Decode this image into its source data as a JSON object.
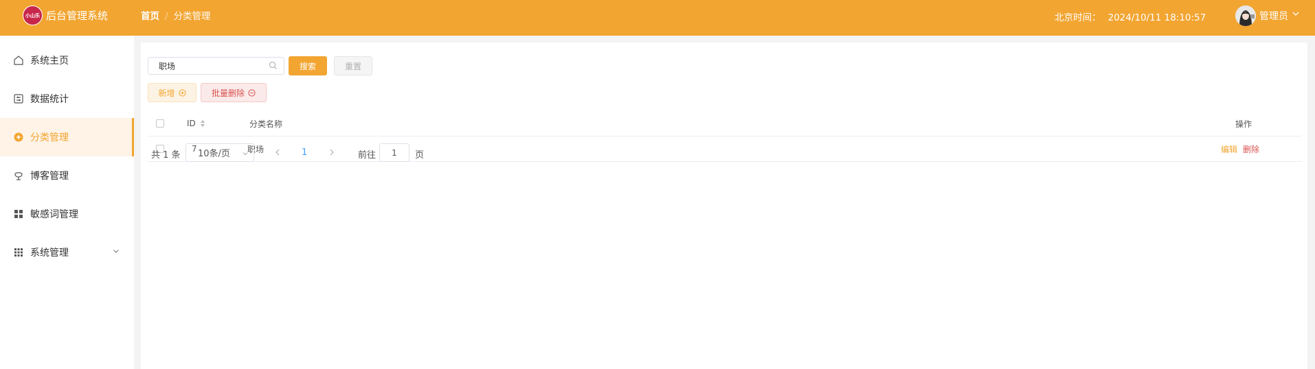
{
  "header": {
    "logo_text": "小山乐",
    "app_title": "后台管理系统",
    "breadcrumb": {
      "home": "首页",
      "separator": "/",
      "current": "分类管理"
    },
    "clock": {
      "label": "北京时间：",
      "value": "2024/10/11 18:10:57"
    },
    "user": {
      "name": "管理员"
    },
    "colors": {
      "primary": "#f2a531",
      "logo_bg": "#c8264b",
      "danger": "#d9534f",
      "link": "#409eff"
    }
  },
  "sidebar": {
    "items": [
      {
        "label": "系统主页",
        "icon": "home-icon"
      },
      {
        "label": "数据统计",
        "icon": "stats-icon"
      },
      {
        "label": "分类管理",
        "icon": "category-icon",
        "active": true
      },
      {
        "label": "博客管理",
        "icon": "blog-icon"
      },
      {
        "label": "敏感词管理",
        "icon": "grid-icon"
      },
      {
        "label": "系统管理",
        "icon": "apps-icon",
        "expandable": true
      }
    ]
  },
  "toolbar": {
    "search_value": "职场",
    "search_button": "搜索",
    "reset_button": "重置",
    "add_button": "新增",
    "batch_delete_button": "批量删除"
  },
  "table": {
    "columns": {
      "id": "ID",
      "name": "分类名称",
      "actions": "操作"
    },
    "rows": [
      {
        "id": "7",
        "name": "职场",
        "edit": "编辑",
        "delete": "删除"
      }
    ]
  },
  "pagination": {
    "total_text": "共 1 条",
    "page_size": "10条/页",
    "current_page": "1",
    "goto_label": "前往",
    "goto_value": "1",
    "page_suffix": "页"
  }
}
